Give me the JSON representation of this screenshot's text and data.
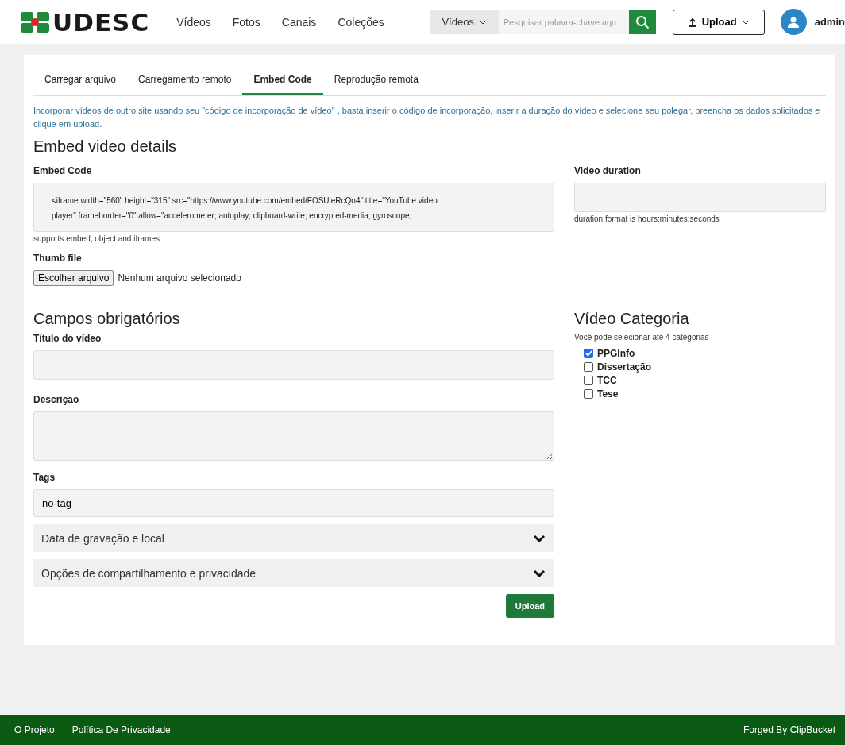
{
  "header": {
    "logo": "UDESC",
    "nav": [
      {
        "label": "Vídeos"
      },
      {
        "label": "Fotos"
      },
      {
        "label": "Canais"
      },
      {
        "label": "Coleções"
      }
    ],
    "search_type": "Vídeos",
    "search_placeholder": "Pesquisar palavra-chave aqu",
    "upload_button": "Upload",
    "user": "admin"
  },
  "tabs": [
    {
      "label": "Carregar arquivo",
      "selected": false
    },
    {
      "label": "Carregamento remoto",
      "selected": false
    },
    {
      "label": "Embed Code",
      "selected": true
    },
    {
      "label": "Reprodução remota",
      "selected": false
    }
  ],
  "intro": "Incorporar vídeos de outro site usando seu \"código de incorporação de vídeo\" , basta inserir o código de incorporação, inserir a duração do vídeo e selecione seu polegar, preencha os dados solicitados e clique em upload.",
  "embed_section": {
    "title": "Embed video details",
    "embed_code": {
      "label": "Embed Code",
      "value_lines": [
        "<iframe width=\"560\" height=\"315\" src=\"https://www.youtube.com/embed/FOSUleRcQo4\" title=\"YouTube video",
        "player\" frameborder=\"0\" allow=\"accelerometer; autoplay; clipboard-write; encrypted-media; gyroscope;"
      ],
      "help": "supports embed, object and iframes"
    },
    "duration": {
      "label": "Video duration",
      "help": "duration format is hours:minutes:seconds"
    },
    "thumb": {
      "label": "Thumb file",
      "button": "Escolher arquivo",
      "status": "Nenhum arquivo selecionado"
    }
  },
  "required_section": {
    "title": "Campos obrigatórios",
    "title_field": {
      "label": "Título do vídeo"
    },
    "description_field": {
      "label": "Descrição"
    },
    "tags_field": {
      "label": "Tags",
      "value": "no-tag"
    },
    "collapsibles": [
      {
        "label": "Data de gravação e local",
        "expanded": false
      },
      {
        "label": "Opções de compartilhamento e privacidade",
        "expanded": false
      }
    ],
    "submit": "Upload"
  },
  "category_section": {
    "title": "Vídeo Categoria",
    "help": "Você pode selecionar até 4 categorias",
    "categories": [
      {
        "label": "PPGInfo",
        "checked": true
      },
      {
        "label": "Dissertação",
        "checked": false
      },
      {
        "label": "TCC",
        "checked": false
      },
      {
        "label": "Tese",
        "checked": false
      }
    ]
  },
  "footer": {
    "links": [
      {
        "label": "O Projeto"
      },
      {
        "label": "Política De Privacidade"
      }
    ],
    "credit": "Forged By ClipBucket"
  }
}
